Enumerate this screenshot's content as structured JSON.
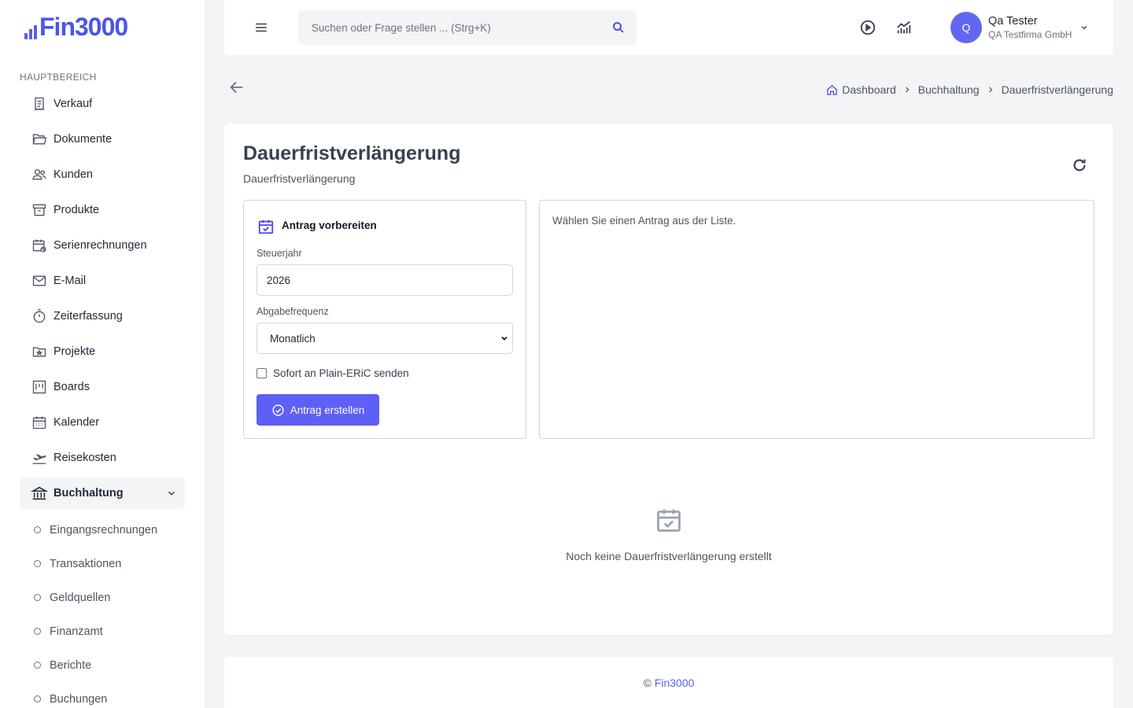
{
  "brand": {
    "logo_text_1": "Fin",
    "logo_text_2": "3000",
    "accent_color": "#5d5ff5"
  },
  "sidebar": {
    "section_title": "HAUPTBEREICH",
    "items": [
      {
        "label": "Verkauf",
        "icon": "receipt-icon"
      },
      {
        "label": "Dokumente",
        "icon": "folder-open-icon"
      },
      {
        "label": "Kunden",
        "icon": "users-icon"
      },
      {
        "label": "Produkte",
        "icon": "archive-box-icon"
      },
      {
        "label": "Serienrechnungen",
        "icon": "calendar-recurring-icon"
      },
      {
        "label": "E-Mail",
        "icon": "mail-icon"
      },
      {
        "label": "Zeiterfassung",
        "icon": "stopwatch-icon"
      },
      {
        "label": "Projekte",
        "icon": "folder-star-icon"
      },
      {
        "label": "Boards",
        "icon": "kanban-board-icon"
      },
      {
        "label": "Kalender",
        "icon": "calendar-icon"
      },
      {
        "label": "Reisekosten",
        "icon": "plane-departure-icon"
      },
      {
        "label": "Buchhaltung",
        "icon": "bank-icon",
        "active": true,
        "expanded": true
      }
    ],
    "sub_items": [
      {
        "label": "Eingangsrechnungen"
      },
      {
        "label": "Transaktionen"
      },
      {
        "label": "Geldquellen"
      },
      {
        "label": "Finanzamt"
      },
      {
        "label": "Berichte"
      },
      {
        "label": "Buchungen"
      }
    ]
  },
  "header": {
    "search_placeholder": "Suchen oder Frage stellen ... (Strg+K)",
    "user": {
      "initial": "Q",
      "name": "Qa Tester",
      "company": "QA Testfirma GmbH"
    }
  },
  "breadcrumb": {
    "items": [
      "Dashboard",
      "Buchhaltung",
      "Dauerfristverlängerung"
    ]
  },
  "page": {
    "title": "Dauerfristverlängerung",
    "subtitle": "Dauerfristverlängerung"
  },
  "form": {
    "heading": "Antrag vorbereiten",
    "tax_year_label": "Steuerjahr",
    "tax_year_value": "2026",
    "frequency_label": "Abgabefrequenz",
    "frequency_value": "Monatlich",
    "send_checkbox_label": "Sofort an Plain-ERiC senden",
    "send_checkbox_checked": false,
    "submit_label": "Antrag erstellen"
  },
  "detail_panel": {
    "message": "Wählen Sie einen Antrag aus der Liste."
  },
  "empty_state": {
    "message": "Noch keine Dauerfristverlängerung erstellt"
  },
  "footer": {
    "copyright": "©",
    "link": "Fin3000"
  }
}
